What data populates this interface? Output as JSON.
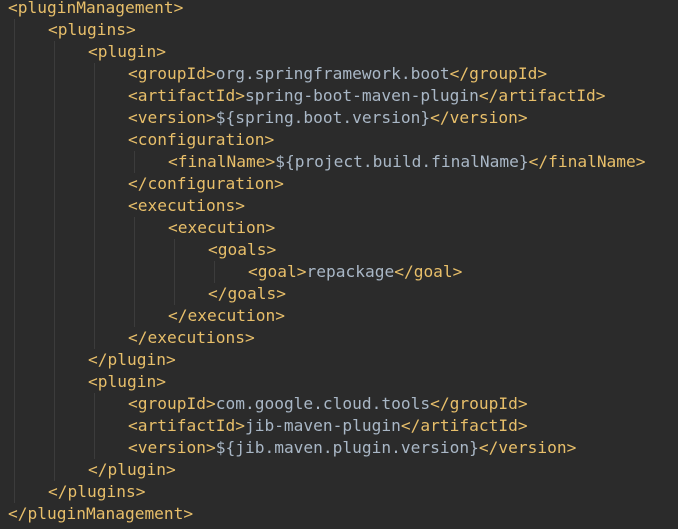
{
  "editor": {
    "lines": [
      {
        "indent": 0,
        "parts": [
          [
            "tag",
            "<pluginManagement>"
          ]
        ]
      },
      {
        "indent": 1,
        "parts": [
          [
            "tag",
            "<plugins>"
          ]
        ]
      },
      {
        "indent": 2,
        "parts": [
          [
            "tag",
            "<plugin>"
          ]
        ]
      },
      {
        "indent": 3,
        "parts": [
          [
            "tag",
            "<groupId>"
          ],
          [
            "txt",
            "org.springframework.boot"
          ],
          [
            "tag",
            "</groupId>"
          ]
        ]
      },
      {
        "indent": 3,
        "parts": [
          [
            "tag",
            "<artifactId>"
          ],
          [
            "txt",
            "spring-boot-maven-plugin"
          ],
          [
            "tag",
            "</artifactId>"
          ]
        ]
      },
      {
        "indent": 3,
        "parts": [
          [
            "tag",
            "<version>"
          ],
          [
            "txt",
            "${spring.boot.version}"
          ],
          [
            "tag",
            "</version>"
          ]
        ]
      },
      {
        "indent": 3,
        "parts": [
          [
            "tag",
            "<configuration>"
          ]
        ]
      },
      {
        "indent": 4,
        "parts": [
          [
            "tag",
            "<finalName>"
          ],
          [
            "txt",
            "${project.build.finalName}"
          ],
          [
            "tag",
            "</finalName>"
          ]
        ]
      },
      {
        "indent": 3,
        "parts": [
          [
            "tag",
            "</configuration>"
          ]
        ]
      },
      {
        "indent": 3,
        "parts": [
          [
            "tag",
            "<executions>"
          ]
        ]
      },
      {
        "indent": 4,
        "parts": [
          [
            "tag",
            "<execution>"
          ]
        ]
      },
      {
        "indent": 5,
        "parts": [
          [
            "tag",
            "<goals>"
          ]
        ]
      },
      {
        "indent": 6,
        "parts": [
          [
            "tag",
            "<goal>"
          ],
          [
            "txt",
            "repackage"
          ],
          [
            "tag",
            "</goal>"
          ]
        ]
      },
      {
        "indent": 5,
        "parts": [
          [
            "tag",
            "</goals>"
          ]
        ]
      },
      {
        "indent": 4,
        "parts": [
          [
            "tag",
            "</execution>"
          ]
        ]
      },
      {
        "indent": 3,
        "parts": [
          [
            "tag",
            "</executions>"
          ]
        ]
      },
      {
        "indent": 2,
        "parts": [
          [
            "tag",
            "</plugin>"
          ]
        ]
      },
      {
        "indent": 2,
        "parts": [
          [
            "tag",
            "<plugin>"
          ]
        ]
      },
      {
        "indent": 3,
        "parts": [
          [
            "tag",
            "<groupId>"
          ],
          [
            "txt",
            "com.google.cloud.tools"
          ],
          [
            "tag",
            "</groupId>"
          ]
        ]
      },
      {
        "indent": 3,
        "parts": [
          [
            "tag",
            "<artifactId>"
          ],
          [
            "txt",
            "jib-maven-plugin"
          ],
          [
            "tag",
            "</artifactId>"
          ]
        ]
      },
      {
        "indent": 3,
        "parts": [
          [
            "tag",
            "<version>"
          ],
          [
            "txt",
            "${jib.maven.plugin.version}"
          ],
          [
            "tag",
            "</version>"
          ]
        ]
      },
      {
        "indent": 2,
        "parts": [
          [
            "tag",
            "</plugin>"
          ]
        ]
      },
      {
        "indent": 1,
        "parts": [
          [
            "tag",
            "</plugins>"
          ]
        ]
      },
      {
        "indent": 0,
        "parts": [
          [
            "tag",
            "</pluginManagement>"
          ]
        ]
      }
    ]
  },
  "colors": {
    "background": "#2b2b2b",
    "tag": "#e8bf6a",
    "text": "#a9b7c6",
    "indent_guide": "#3c3c3c"
  }
}
